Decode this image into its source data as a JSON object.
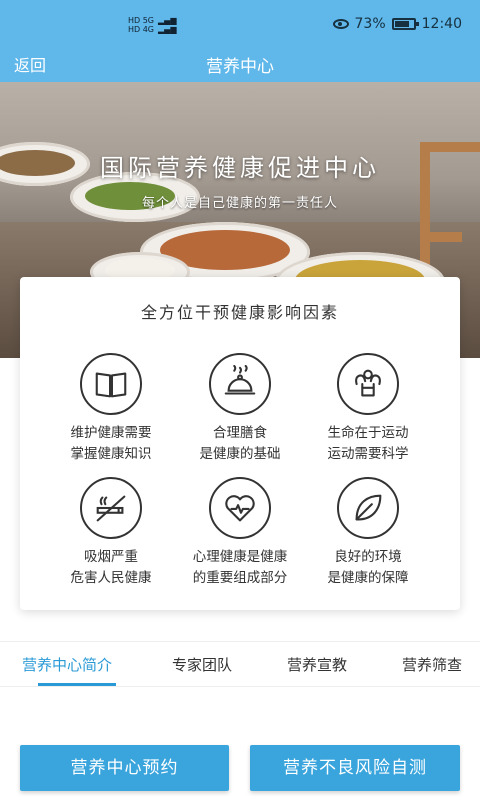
{
  "status_bar": {
    "network_top": "HD 5G",
    "network_bottom": "HD 4G",
    "battery": "73%",
    "time": "12:40"
  },
  "nav": {
    "back_label": "返回",
    "title": "营养中心"
  },
  "hero": {
    "title": "国际营养健康促进中心",
    "subtitle": "每个人是自己健康的第一责任人"
  },
  "card": {
    "title": "全方位干预健康影响因素",
    "factors": [
      {
        "icon": "book-icon",
        "text": "维护健康需要\n掌握健康知识"
      },
      {
        "icon": "food-cloche-icon",
        "text": "合理膳食\n是健康的基础"
      },
      {
        "icon": "muscle-icon",
        "text": "生命在于运动\n运动需要科学"
      },
      {
        "icon": "no-smoking-icon",
        "text": "吸烟严重\n危害人民健康"
      },
      {
        "icon": "heart-hands-icon",
        "text": "心理健康是健康\n的重要组成部分"
      },
      {
        "icon": "leaf-icon",
        "text": "良好的环境\n是健康的保障"
      }
    ]
  },
  "tabs": [
    {
      "label": "营养中心简介",
      "active": true
    },
    {
      "label": "专家团队",
      "active": false
    },
    {
      "label": "营养宣教",
      "active": false
    },
    {
      "label": "营养筛查",
      "active": false
    }
  ],
  "buttons": {
    "appointment": "营养中心预约",
    "self_test": "营养不良风险自测"
  },
  "colors": {
    "header": "#5fb7ea",
    "accent": "#2a9ad6",
    "button": "#3aa5dd"
  }
}
